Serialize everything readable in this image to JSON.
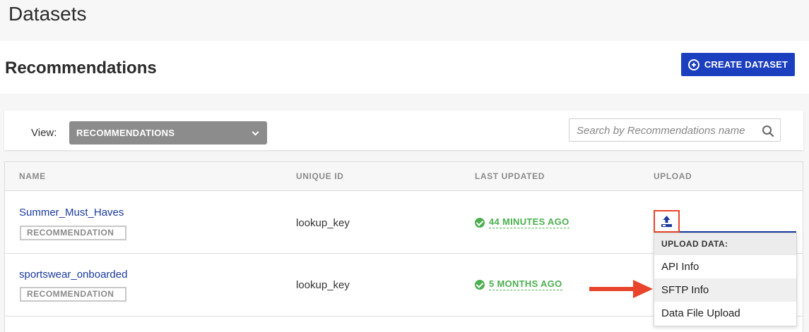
{
  "page": {
    "title": "Datasets"
  },
  "section": {
    "title": "Recommendations",
    "create_label": "CREATE DATASET"
  },
  "filter": {
    "view_label": "View:",
    "view_value": "RECOMMENDATIONS",
    "search_placeholder": "Search by Recommendations name"
  },
  "table": {
    "columns": [
      "NAME",
      "UNIQUE ID",
      "LAST UPDATED",
      "UPLOAD"
    ],
    "rows": [
      {
        "name": "Summer_Must_Haves",
        "badge": "RECOMMENDATION",
        "unique_id": "lookup_key",
        "last_updated": "44 MINUTES AGO"
      },
      {
        "name": "sportswear_onboarded",
        "badge": "RECOMMENDATION",
        "unique_id": "lookup_key",
        "last_updated": "5 MONTHS AGO"
      }
    ]
  },
  "upload_menu": {
    "header": "UPLOAD DATA:",
    "items": [
      "API Info",
      "SFTP Info",
      "Data File Upload"
    ]
  },
  "colors": {
    "primary": "#1b3fbf",
    "success": "#4caf50",
    "highlight": "#e8452c",
    "link": "#1b3a9e"
  },
  "icons": {
    "create": "plus-circle-icon",
    "dropdown": "chevron-down-icon",
    "search": "search-icon",
    "status": "check-circle-icon",
    "upload": "upload-icon",
    "annotation": "red-arrow-icon"
  }
}
